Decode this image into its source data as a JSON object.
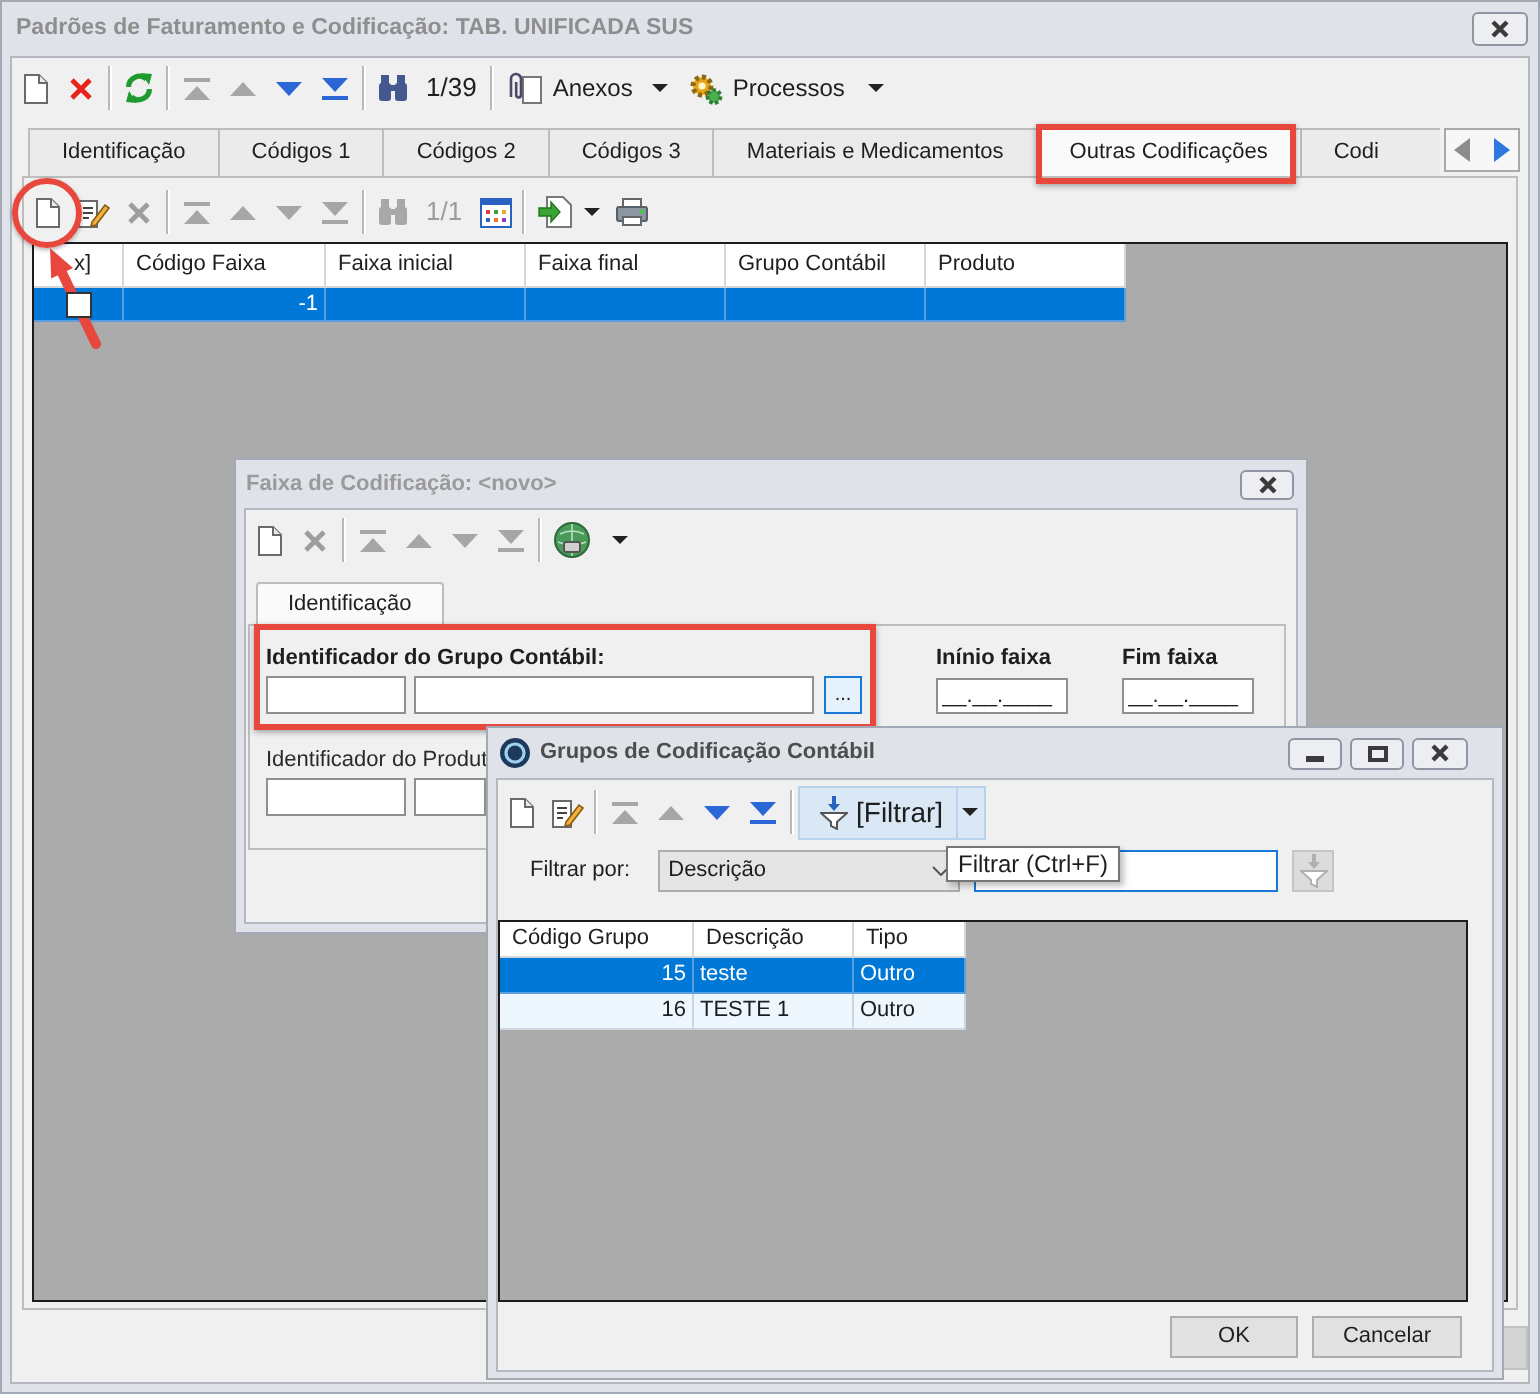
{
  "main_window": {
    "title": "Padrões de Faturamento e Codificação: TAB. UNIFICADA SUS",
    "active": false,
    "toolbar": [
      [
        {
          "kind": "new",
          "disabled": false
        },
        {
          "kind": "delete",
          "disabled": false
        }
      ],
      [
        {
          "kind": "refresh",
          "disabled": false
        }
      ],
      [
        {
          "kind": "first",
          "disabled": true
        },
        {
          "kind": "previous",
          "disabled": true
        },
        {
          "kind": "next",
          "disabled": false
        },
        {
          "kind": "last",
          "disabled": false
        }
      ],
      [
        {
          "kind": "search",
          "disabled": false
        },
        {
          "kind": "counter",
          "label": "1/39",
          "disabled": false
        }
      ],
      [
        {
          "kind": "attachments",
          "label": "Anexos",
          "disabled": false
        },
        {
          "kind": "processes",
          "label": "Processos",
          "disabled": false
        }
      ]
    ],
    "tabs": [
      {
        "label": "Identificação",
        "selected": false,
        "highlighted": false
      },
      {
        "label": "Códigos 1",
        "selected": false,
        "highlighted": false
      },
      {
        "label": "Códigos 2",
        "selected": false,
        "highlighted": false
      },
      {
        "label": "Códigos 3",
        "selected": false,
        "highlighted": false
      },
      {
        "label": "Materiais e Medicamentos",
        "selected": false,
        "highlighted": false
      },
      {
        "label": "Outras Codificações",
        "selected": true,
        "highlighted": true
      },
      {
        "label": "Codi",
        "selected": false,
        "highlighted": false
      }
    ],
    "tab_toolbar": [
      [
        {
          "kind": "new",
          "disabled": false,
          "circled": true
        },
        {
          "kind": "edit",
          "disabled": false,
          "circled": false
        },
        {
          "kind": "delete",
          "disabled": true,
          "circled": false
        }
      ],
      [
        {
          "kind": "first",
          "disabled": true,
          "circled": false
        },
        {
          "kind": "previous",
          "disabled": true,
          "circled": false
        },
        {
          "kind": "next",
          "disabled": true,
          "circled": false
        },
        {
          "kind": "last",
          "disabled": true,
          "circled": false
        }
      ],
      [
        {
          "kind": "search",
          "disabled": true,
          "circled": false
        },
        {
          "kind": "counter",
          "label": "1/1",
          "disabled": true,
          "circled": false
        },
        {
          "kind": "grid",
          "disabled": false,
          "circled": false
        }
      ],
      [
        {
          "kind": "export",
          "disabled": false,
          "circled": false
        },
        {
          "kind": "print",
          "disabled": false,
          "circled": false
        }
      ]
    ],
    "grid": {
      "columns": [
        "x]",
        "Código Faixa",
        "Faixa inicial",
        "Faixa final",
        "Grupo Contábil",
        "Produto"
      ],
      "rows": [
        {
          "selected": true,
          "checked": false,
          "cells": [
            "-1"
          ]
        }
      ]
    }
  },
  "range_dialog": {
    "title": "Faixa de Codificação: <novo>",
    "active": false,
    "toolbar": [
      [
        {
          "kind": "new",
          "disabled": false
        },
        {
          "kind": "delete",
          "disabled": true
        }
      ],
      [
        {
          "kind": "first",
          "disabled": true
        },
        {
          "kind": "previous",
          "disabled": true
        },
        {
          "kind": "next",
          "disabled": true
        },
        {
          "kind": "last",
          "disabled": true
        }
      ],
      [
        {
          "kind": "globe",
          "disabled": false
        }
      ]
    ],
    "tabs": [
      {
        "label": "Identificação",
        "selected": true
      }
    ],
    "group_field": {
      "label": "Identificador do Grupo Contábil:",
      "highlighted": true,
      "browse": {
        "label": "...",
        "focused": true
      }
    },
    "range_fields": [
      {
        "label": "Inínio faixa",
        "value": "__.__.____"
      },
      {
        "label": "Fim faixa",
        "value": "__.__.____"
      }
    ],
    "product_field": {
      "label": "Identificador do Produt"
    }
  },
  "groups_dialog": {
    "title": "Grupos de Codificação Contábil",
    "active": true,
    "toolbar": [
      [
        {
          "kind": "new",
          "disabled": false,
          "hovered": false
        },
        {
          "kind": "edit",
          "disabled": false,
          "hovered": false
        }
      ],
      [
        {
          "kind": "first",
          "disabled": true,
          "hovered": false
        },
        {
          "kind": "previous",
          "disabled": true,
          "hovered": false
        },
        {
          "kind": "next",
          "disabled": false,
          "hovered": false
        },
        {
          "kind": "last",
          "disabled": false,
          "hovered": false
        }
      ],
      [
        {
          "kind": "filter",
          "label": "[Filtrar]",
          "disabled": false,
          "hovered": true
        }
      ]
    ],
    "tooltip": "Filtrar (Ctrl+F)",
    "filter": {
      "label": "Filtrar por:",
      "field": "Descrição",
      "text_field": {
        "focused": true
      },
      "apply_button": {
        "disabled": true
      }
    },
    "grid": {
      "columns": [
        "Código Grupo",
        "Descrição",
        "Tipo"
      ],
      "rows": [
        {
          "selected": true,
          "cells": [
            "15",
            "teste",
            "Outro"
          ]
        },
        {
          "selected": false,
          "cells": [
            "16",
            "TESTE 1",
            "Outro"
          ]
        }
      ]
    },
    "buttons": [
      "OK",
      "Cancelar"
    ]
  }
}
